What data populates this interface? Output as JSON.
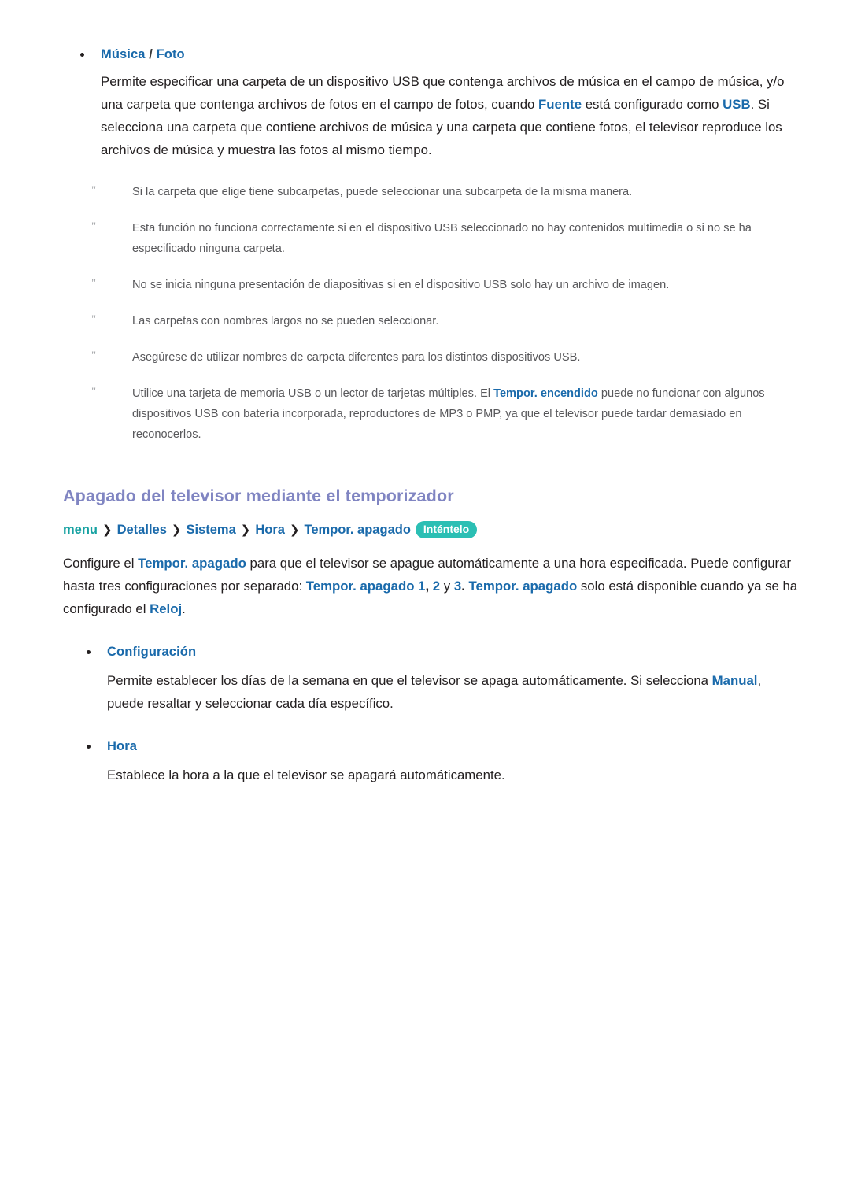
{
  "sections": {
    "music_photo": {
      "bullet_title_parts": {
        "first": "Música",
        "separator": " / ",
        "second": "Foto"
      },
      "paragraph": {
        "t1": "Permite especificar una carpeta de un dispositivo USB que contenga archivos de música en el campo de música, y/o una carpeta que contenga archivos de fotos en el campo de fotos, cuando ",
        "a1": "Fuente",
        "t2": " está configurado como ",
        "a2": "USB",
        "t3": ". Si selecciona una carpeta que contiene archivos de música y una carpeta que contiene fotos, el televisor reproduce los archivos de música y muestra las fotos al mismo tiempo."
      },
      "notes": [
        {
          "marker": "\"",
          "t1": "Si la carpeta que elige tiene subcarpetas, puede seleccionar una subcarpeta de la misma manera.",
          "a1": "",
          "t2": ""
        },
        {
          "marker": "\"",
          "t1": "Esta función no funciona correctamente si en el dispositivo USB seleccionado no hay contenidos multimedia o si no se ha especificado ninguna carpeta.",
          "a1": "",
          "t2": ""
        },
        {
          "marker": "\"",
          "t1": "No se inicia ninguna presentación de diapositivas si en el dispositivo USB solo hay un archivo de imagen.",
          "a1": "",
          "t2": ""
        },
        {
          "marker": "\"",
          "t1": "Las carpetas con nombres largos no se pueden seleccionar.",
          "a1": "",
          "t2": ""
        },
        {
          "marker": "\"",
          "t1": "Asegúrese de utilizar nombres de carpeta diferentes para los distintos dispositivos USB.",
          "a1": "",
          "t2": ""
        },
        {
          "marker": "\"",
          "t1": "Utilice una tarjeta de memoria USB o un lector de tarjetas múltiples. El ",
          "a1": "Tempor. encendido",
          "t2": " puede no funcionar con algunos dispositivos USB con batería incorporada, reproductores de MP3 o PMP, ya que el televisor puede tardar demasiado en reconocerlos."
        }
      ]
    },
    "sleep_timer": {
      "heading": "Apagado del televisor mediante el temporizador",
      "breadcrumb": {
        "root": "menu",
        "chevron": "❯",
        "items": [
          "Detalles",
          "Sistema",
          "Hora",
          "Tempor. apagado"
        ],
        "try_label": "Inténtelo"
      },
      "paragraph": {
        "t1": "Configure el ",
        "a1": "Tempor. apagado",
        "t2": " para que el televisor se apague automáticamente a una hora especificada. Puede configurar hasta tres configuraciones por separado: ",
        "a2": "Tempor. apagado 1",
        "t3": ", ",
        "a3": "2",
        "t4": " y ",
        "a4": "3",
        "t5": ". ",
        "a5": "Tempor. apagado",
        "t6": " solo está disponible cuando ya se ha configurado el ",
        "a6": "Reloj",
        "t7": "."
      },
      "sub_blocks": [
        {
          "title": "Configuración",
          "t1": "Permite establecer los días de la semana en que el televisor se apaga automáticamente. Si selecciona ",
          "a1": "Manual",
          "t2": ", puede resaltar y seleccionar cada día específico."
        },
        {
          "title": "Hora",
          "t1": "Establece la hora a la que el televisor se apagará automáticamente.",
          "a1": "",
          "t2": ""
        }
      ]
    }
  },
  "colors": {
    "accent_blue": "#1a6aab",
    "heading_purple": "#8085c2",
    "teal": "#17a2a2",
    "pill_teal": "#2bbfb4",
    "body": "#231f20",
    "note_gray": "#58585b",
    "ditto_gray": "#a7a9ac"
  }
}
